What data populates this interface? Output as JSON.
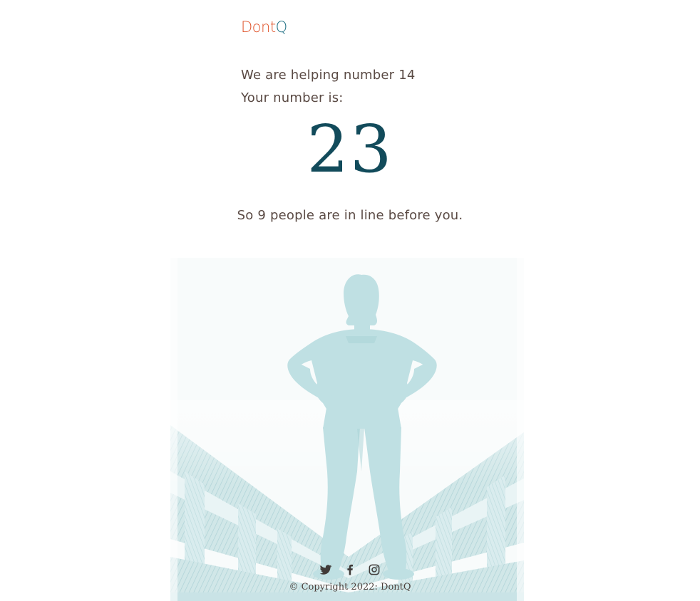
{
  "brand": {
    "logo_part1": "Dont",
    "logo_part2": "Q"
  },
  "queue": {
    "helping_line": "We are helping number 14",
    "your_label": "Your number is:",
    "your_number": "23",
    "ahead_line": "So 9 people are in line before you."
  },
  "hero": {
    "image_name": "silhouette-on-bridge-illustration"
  },
  "footer": {
    "social": [
      {
        "icon": "twitter-icon"
      },
      {
        "icon": "facebook-icon"
      },
      {
        "icon": "instagram-icon"
      }
    ],
    "copyright": "© Copyright 2022: DontQ"
  },
  "colors": {
    "logo_orange": "#e0562e",
    "logo_teal": "#1f6f83",
    "number": "#124b5b",
    "text": "#5a4a44",
    "hero_tint": "#bfe0e3"
  }
}
